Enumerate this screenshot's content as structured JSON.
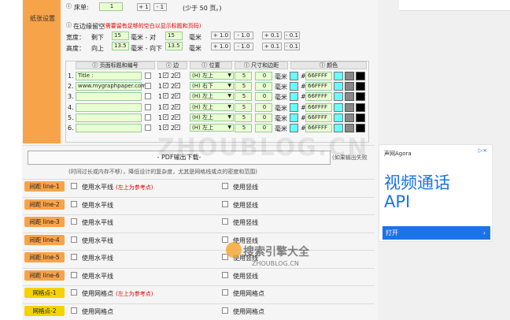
{
  "section": {
    "label": "纸张设置"
  },
  "pages": {
    "label": "床单:",
    "value": "1",
    "plus": "+ 1",
    "minus": "- 1",
    "note": "(少于 50 页。)"
  },
  "margin": {
    "label": "在边缘留空",
    "hint": "(需要留有足够的空白以显示标题和页码)",
    "width_label": "宽度：",
    "height_label": "高度：",
    "left": "剩下",
    "right": "毫米 - 对",
    "top": "向上",
    "bottom": "毫米 - 向下",
    "unit": "毫米",
    "w1": "15",
    "w2": "15",
    "h1": "13.5",
    "h2": "13.5",
    "b1": "+ 1.0",
    "b2": "- 1.0",
    "b3": "+ 0.1",
    "b4": "- 0.1"
  },
  "table": {
    "headers": [
      "页面标题和编号",
      "边",
      "位置",
      "尺寸和边距",
      "颜色"
    ],
    "rows": [
      {
        "n": "1.",
        "text": "Title :",
        "pos": "(H) 左上",
        "s": "5",
        "m": "0",
        "unit": "毫米",
        "color": "66FFFF"
      },
      {
        "n": "2.",
        "text": "www.mygraphpaper.com",
        "pos": "(H) 右下",
        "s": "5",
        "m": "0",
        "unit": "毫米",
        "color": "66FFFF"
      },
      {
        "n": "3.",
        "text": "",
        "pos": "(H) 左上",
        "s": "5",
        "m": "0",
        "unit": "毫米",
        "color": "66FFFF"
      },
      {
        "n": "4.",
        "text": "",
        "pos": "(H) 左上",
        "s": "5",
        "m": "0",
        "unit": "毫米",
        "color": "66FFFF"
      },
      {
        "n": "5.",
        "text": "",
        "pos": "(H) 左上",
        "s": "5",
        "m": "0",
        "unit": "毫米",
        "color": "66FFFF"
      },
      {
        "n": "6.",
        "text": "",
        "pos": "(H) 左上",
        "s": "5",
        "m": "0",
        "unit": "毫米",
        "color": "66FFFF"
      }
    ],
    "one": "1",
    "two": "2",
    "hash": "#"
  },
  "pdf": {
    "label": "- PDF输出下载-",
    "side": "(如果输出失败",
    "note": "(时间过长或内存不够），降低设计的复杂度，尤其是网格线或点的密度和范围)"
  },
  "lines": [
    {
      "label": "间距 line-1",
      "h": "使用水平线",
      "red": "(左上为参考点)",
      "v": "使用竖线",
      "yellow": false
    },
    {
      "label": "间距 line-2",
      "h": "使用水平线",
      "red": "",
      "v": "使用竖线",
      "yellow": false
    },
    {
      "label": "间距 line-3",
      "h": "使用水平线",
      "red": "",
      "v": "使用竖线",
      "yellow": false
    },
    {
      "label": "间距 line-4",
      "h": "使用水平线",
      "red": "",
      "v": "使用竖线",
      "yellow": false
    },
    {
      "label": "间距 line-5",
      "h": "使用水平线",
      "red": "",
      "v": "使用竖线",
      "yellow": false
    },
    {
      "label": "间距 line-6",
      "h": "使用水平线",
      "red": "",
      "v": "使用竖线",
      "yellow": false
    },
    {
      "label": "网格点-1",
      "h": "使用网格点",
      "red": "(左上为参考点)",
      "v": "使用网格点",
      "yellow": true
    },
    {
      "label": "网格点-2",
      "h": "使用网格点",
      "red": "",
      "v": "使用网格点",
      "yellow": true
    }
  ],
  "ad": {
    "brand": "声网Agora",
    "adchoice": "▷×",
    "headline1": "视频通话",
    "headline2": "API",
    "cta": "打开",
    "cta_arrow": "›"
  },
  "watermark": {
    "text1": "ZHOUBLOG.CN",
    "text2": "搜索引擎大全",
    "text3": "ZHOUBLOG.CN"
  },
  "colors": {
    "accent": "#f7a34a",
    "yellow": "#f5d200",
    "input_bg": "#e9ffd2",
    "cyan": "#66ffff",
    "link": "#1a73e8"
  }
}
